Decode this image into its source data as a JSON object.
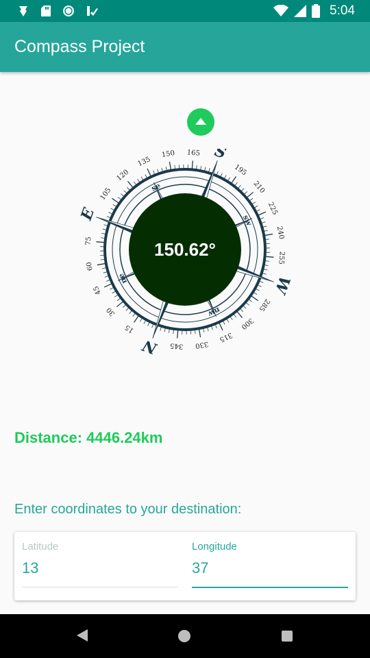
{
  "status_bar": {
    "time": "5:04",
    "left_icons": [
      "vpn-icon",
      "sd-card-icon",
      "sync-icon",
      "check-list-icon"
    ],
    "right_icons": [
      "wifi-icon",
      "signal-icon",
      "battery-icon"
    ]
  },
  "app_bar": {
    "title": "Compass Project",
    "color": "#26a69a",
    "status_color": "#00897b"
  },
  "compass": {
    "heading": "150.62°",
    "cardinals": [
      "N",
      "E",
      "S",
      "W"
    ],
    "intercardinals": [
      "ne",
      "se",
      "sw",
      "nw"
    ],
    "degree_labels": [
      "15",
      "30",
      "45",
      "60",
      "75",
      "105",
      "120",
      "135",
      "150",
      "165",
      "195",
      "210",
      "225",
      "240",
      "255",
      "285",
      "300",
      "315",
      "330",
      "345"
    ],
    "dial_color": "#1b3a4b",
    "center_color": "#042d02"
  },
  "distance": {
    "text": "Distance: 4446.24km",
    "color": "#1ecb5c"
  },
  "destination": {
    "prompt": "Enter coordinates to your destination:",
    "latitude": {
      "label": "Latitude",
      "value": "13"
    },
    "longitude": {
      "label": "Longitude",
      "value": "37"
    }
  },
  "nav_bar": {
    "buttons": [
      "back-button",
      "home-button",
      "recents-button"
    ]
  }
}
